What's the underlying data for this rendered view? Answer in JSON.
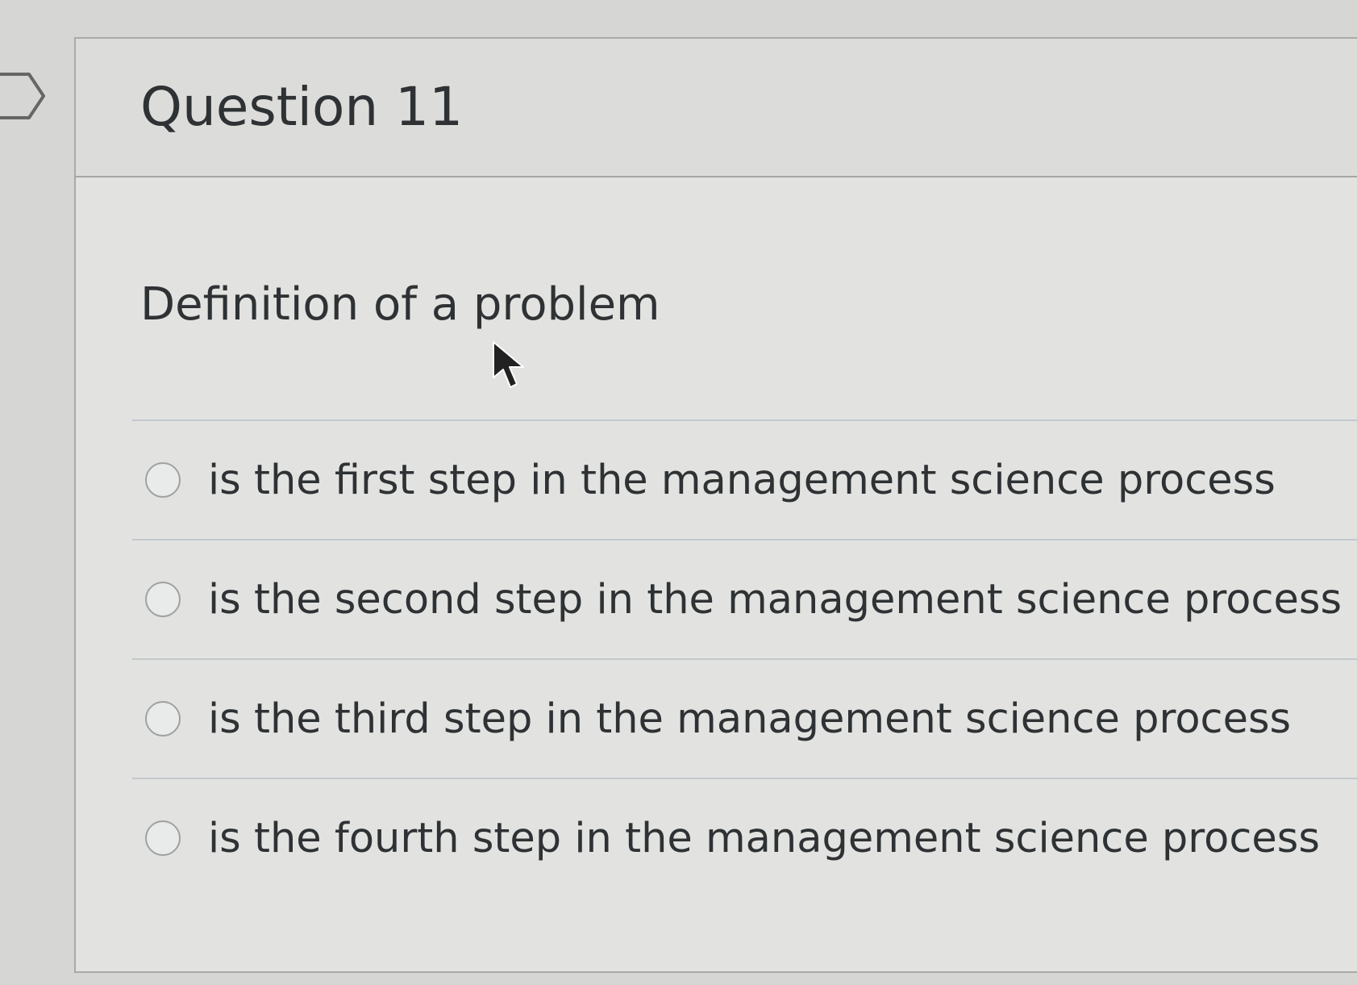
{
  "question": {
    "title": "Question 11",
    "text": "Definition of a problem",
    "options": [
      "is the first step in the management science process",
      "is the second step in the management science process",
      "is the third step in the management science process",
      "is the fourth step in the management science process"
    ]
  },
  "icons": {
    "flag": "flag-icon",
    "cursor": "mouse-pointer-icon",
    "radio": "radio-button-icon"
  },
  "colors": {
    "text": "#2f3234",
    "background": "#e2e3e1",
    "divider": "#c2c8cb"
  }
}
